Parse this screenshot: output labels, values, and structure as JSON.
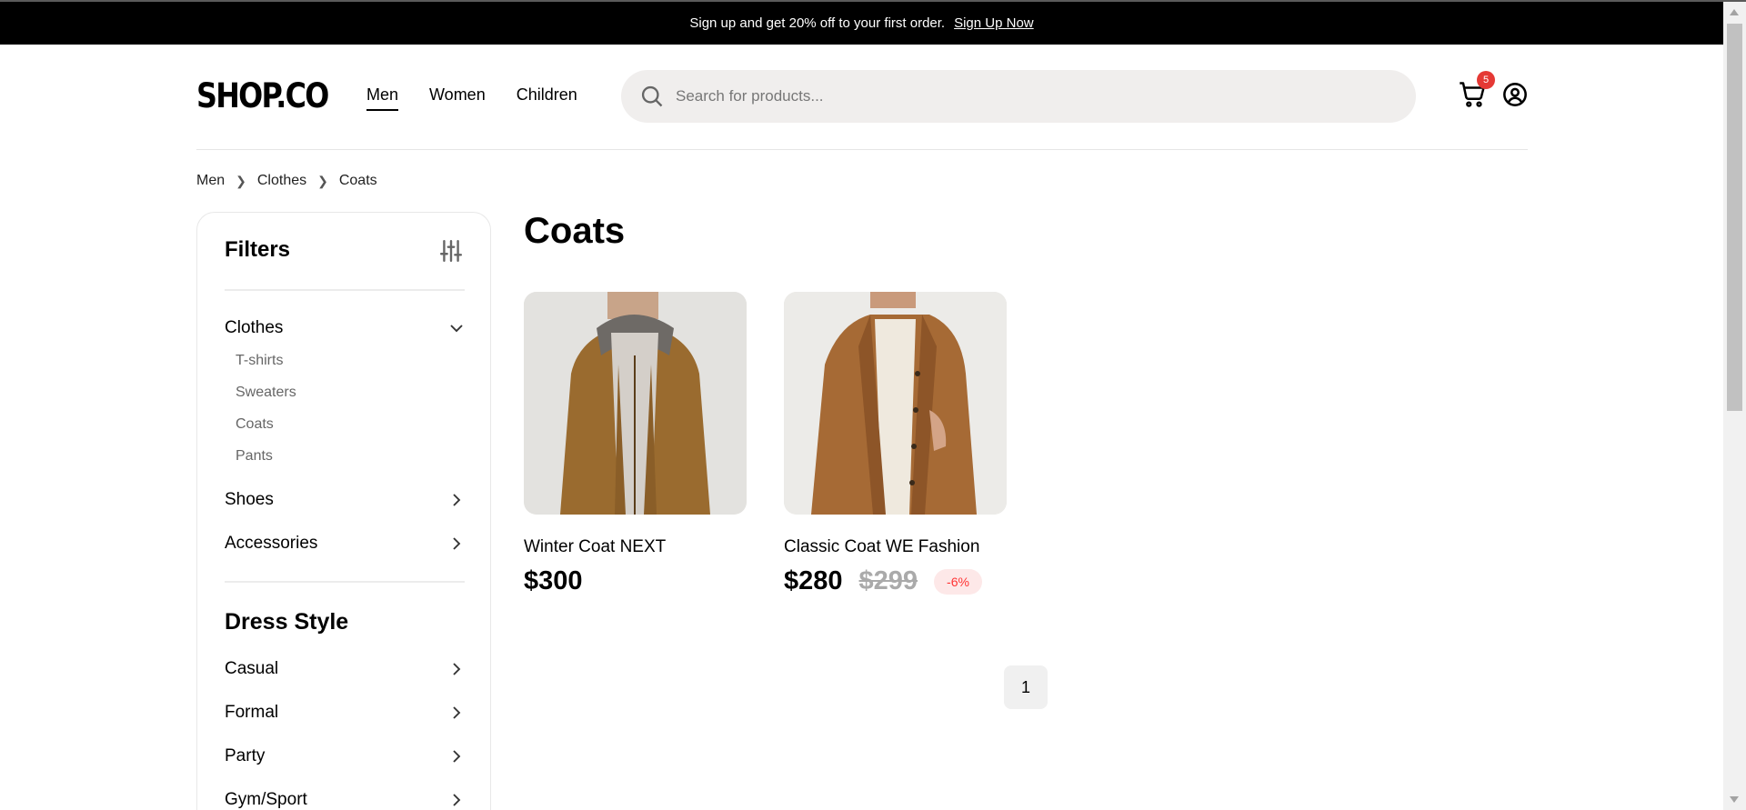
{
  "promo": {
    "text": "Sign up and get 20% off to your first order.",
    "link": "Sign Up Now"
  },
  "header": {
    "logo": "SHOP.CO",
    "nav": [
      "Men",
      "Women",
      "Children"
    ],
    "active_nav": "Men",
    "search_placeholder": "Search for products...",
    "cart_count": "5"
  },
  "breadcrumb": [
    "Men",
    "Clothes",
    "Coats"
  ],
  "filters": {
    "title": "Filters",
    "categories": [
      {
        "label": "Clothes",
        "expanded": true,
        "children": [
          "T-shirts",
          "Sweaters",
          "Coats",
          "Pants"
        ]
      },
      {
        "label": "Shoes"
      },
      {
        "label": "Accessories"
      }
    ],
    "dress_style_title": "Dress Style",
    "dress_styles": [
      "Casual",
      "Formal",
      "Party",
      "Gym/Sport"
    ]
  },
  "page": {
    "title": "Coats"
  },
  "products": [
    {
      "name": "Winter Coat NEXT",
      "price": "$300"
    },
    {
      "name": "Classic Coat WE Fashion",
      "price": "$280",
      "old_price": "$299",
      "discount": "-6%"
    }
  ],
  "pagination": {
    "current": "1"
  },
  "colors": {
    "badge": "#e53935",
    "discount_text": "#ff3333",
    "discount_bg": "#fde8e8"
  }
}
